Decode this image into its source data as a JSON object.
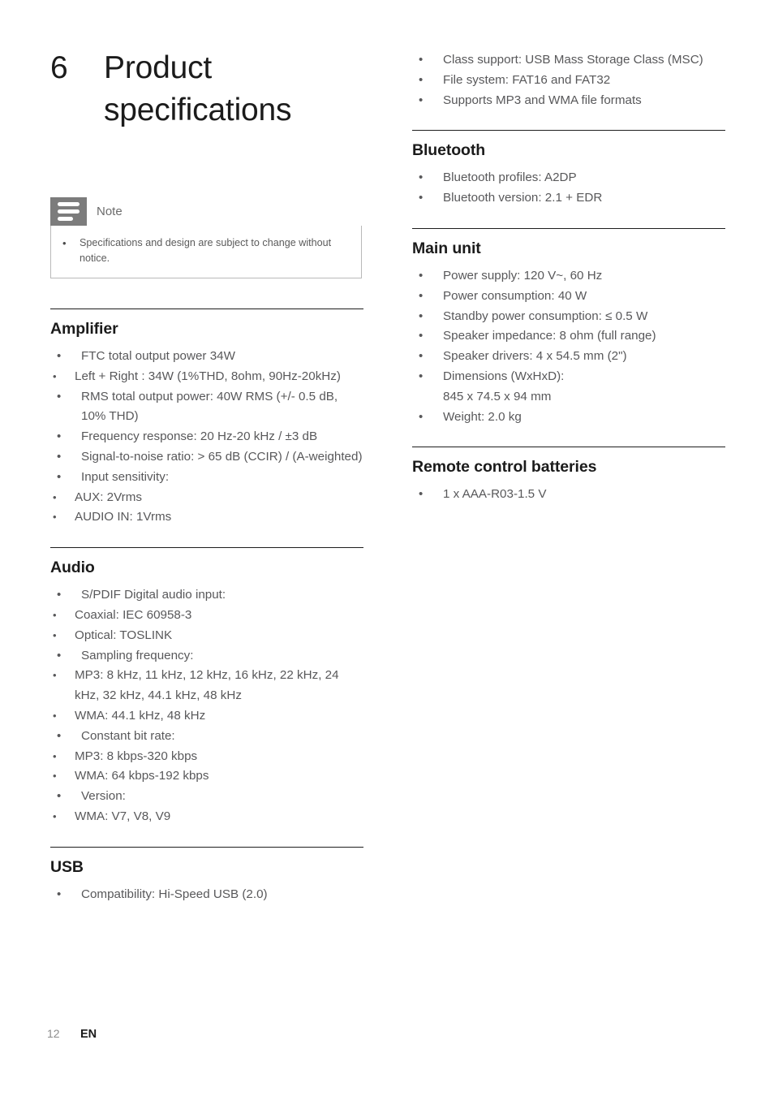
{
  "page": {
    "chapter_number": "6",
    "chapter_title": "Product specifications",
    "footer_page_number": "12",
    "footer_language": "EN"
  },
  "note": {
    "icon": "note-lines-icon",
    "title": "Note",
    "bullet_glyph": "•",
    "text": "Specifications and design are subject to change without notice."
  },
  "glyphs": {
    "bullet1": "•",
    "bullet2": "•"
  },
  "colors": {
    "rule": "#1e1e1e",
    "heading": "#1b1b1b",
    "body": "#58585a",
    "note_tab": "#7c7c7c",
    "note_border": "#b9b9b9",
    "footer_page": "#8c8c8c"
  },
  "left_column": {
    "sections": [
      {
        "title": "Amplifier",
        "items": [
          {
            "text": "FTC total output power 34W",
            "sub": [
              "Left + Right : 34W (1%THD, 8ohm, 90Hz-20kHz)"
            ]
          },
          {
            "text": "RMS total output power: 40W RMS (+/- 0.5 dB, 10% THD)",
            "sub": []
          },
          {
            "text": "Frequency response: 20 Hz-20 kHz / ±3 dB",
            "sub": []
          },
          {
            "text": "Signal-to-noise ratio: > 65 dB (CCIR) / (A-weighted)",
            "sub": []
          },
          {
            "text": "Input sensitivity:",
            "sub": [
              "AUX: 2Vrms",
              "AUDIO IN: 1Vrms"
            ]
          }
        ]
      },
      {
        "title": "Audio",
        "items": [
          {
            "text": "S/PDIF Digital audio input:",
            "sub": [
              "Coaxial: IEC 60958-3",
              "Optical: TOSLINK"
            ]
          },
          {
            "text": "Sampling frequency:",
            "sub": [
              "MP3: 8 kHz, 11 kHz, 12 kHz, 16 kHz, 22 kHz, 24 kHz, 32 kHz, 44.1 kHz, 48 kHz",
              "WMA: 44.1 kHz, 48 kHz"
            ]
          },
          {
            "text": "Constant bit rate:",
            "sub": [
              "MP3: 8 kbps-320 kbps",
              "WMA: 64 kbps-192 kbps"
            ]
          },
          {
            "text": "Version:",
            "sub": [
              "WMA: V7, V8, V9"
            ]
          }
        ]
      },
      {
        "title": "USB",
        "items": [
          {
            "text": "Compatibility: Hi-Speed USB (2.0)",
            "sub": []
          }
        ]
      }
    ]
  },
  "right_column": {
    "continued_items": [
      {
        "text": "Class support: USB Mass Storage Class (MSC)"
      },
      {
        "text": "File system: FAT16 and FAT32"
      },
      {
        "text": "Supports MP3 and WMA file formats"
      }
    ],
    "sections": [
      {
        "title": "Bluetooth",
        "items": [
          {
            "text": "Bluetooth profiles: A2DP",
            "sub": []
          },
          {
            "text": "Bluetooth version: 2.1 + EDR",
            "sub": []
          }
        ]
      },
      {
        "title": "Main unit",
        "items": [
          {
            "text": "Power supply: 120 V~, 60 Hz",
            "sub": []
          },
          {
            "text": "Power consumption: 40 W",
            "sub": []
          },
          {
            "text": "Standby power consumption: ≤ 0.5 W",
            "sub": []
          },
          {
            "text": "Speaker impedance: 8 ohm (full range)",
            "sub": []
          },
          {
            "text": "Speaker drivers: 4 x 54.5 mm (2\")",
            "sub": []
          },
          {
            "text": "Dimensions (WxHxD):\n845 x 74.5 x 94 mm",
            "sub": []
          },
          {
            "text": "Weight: 2.0 kg",
            "sub": []
          }
        ]
      },
      {
        "title": "Remote control batteries",
        "items": [
          {
            "text": "1 x AAA-R03-1.5 V",
            "sub": []
          }
        ]
      }
    ]
  }
}
